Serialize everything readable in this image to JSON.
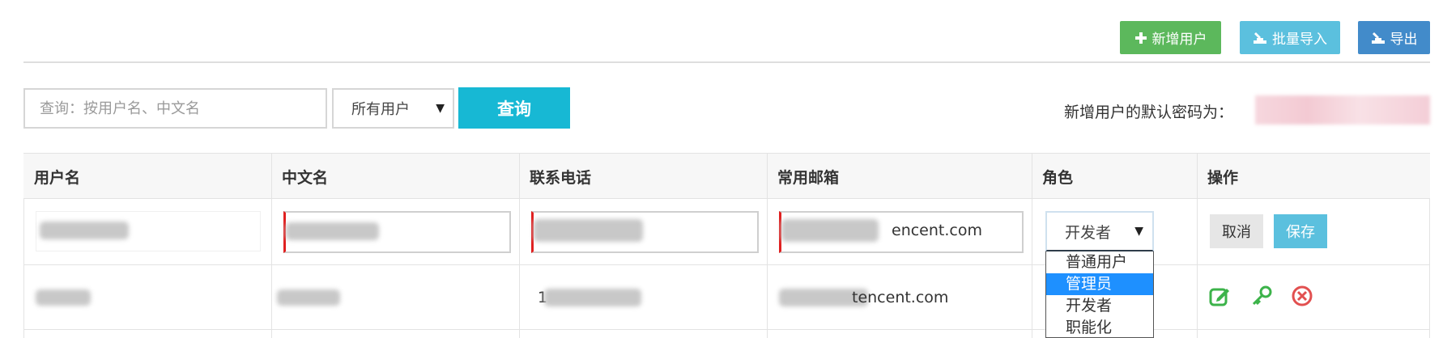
{
  "toolbar": {
    "add_label": "新增用户",
    "import_label": "批量导入",
    "export_label": "导出"
  },
  "search": {
    "placeholder": "查询：按用户名、中文名",
    "filter_value": "所有用户",
    "query_label": "查询",
    "default_password_label": "新增用户的默认密码为："
  },
  "table": {
    "headers": [
      "用户名",
      "中文名",
      "联系电话",
      "常用邮箱",
      "角色",
      "操作"
    ],
    "edit_row": {
      "email_suffix": "encent.com",
      "role_value": "开发者",
      "cancel_label": "取消",
      "save_label": "保存"
    },
    "row2": {
      "phone_prefix": "1",
      "email_suffix": "tencent.com"
    }
  },
  "role_dropdown": {
    "options": [
      "普通用户",
      "管理员",
      "开发者",
      "职能化"
    ],
    "highlighted": "管理员"
  },
  "colors": {
    "add": "#5cb85c",
    "import": "#5bc0de",
    "export": "#428bca",
    "query": "#17b8d4",
    "highlight": "#1e90ff"
  }
}
